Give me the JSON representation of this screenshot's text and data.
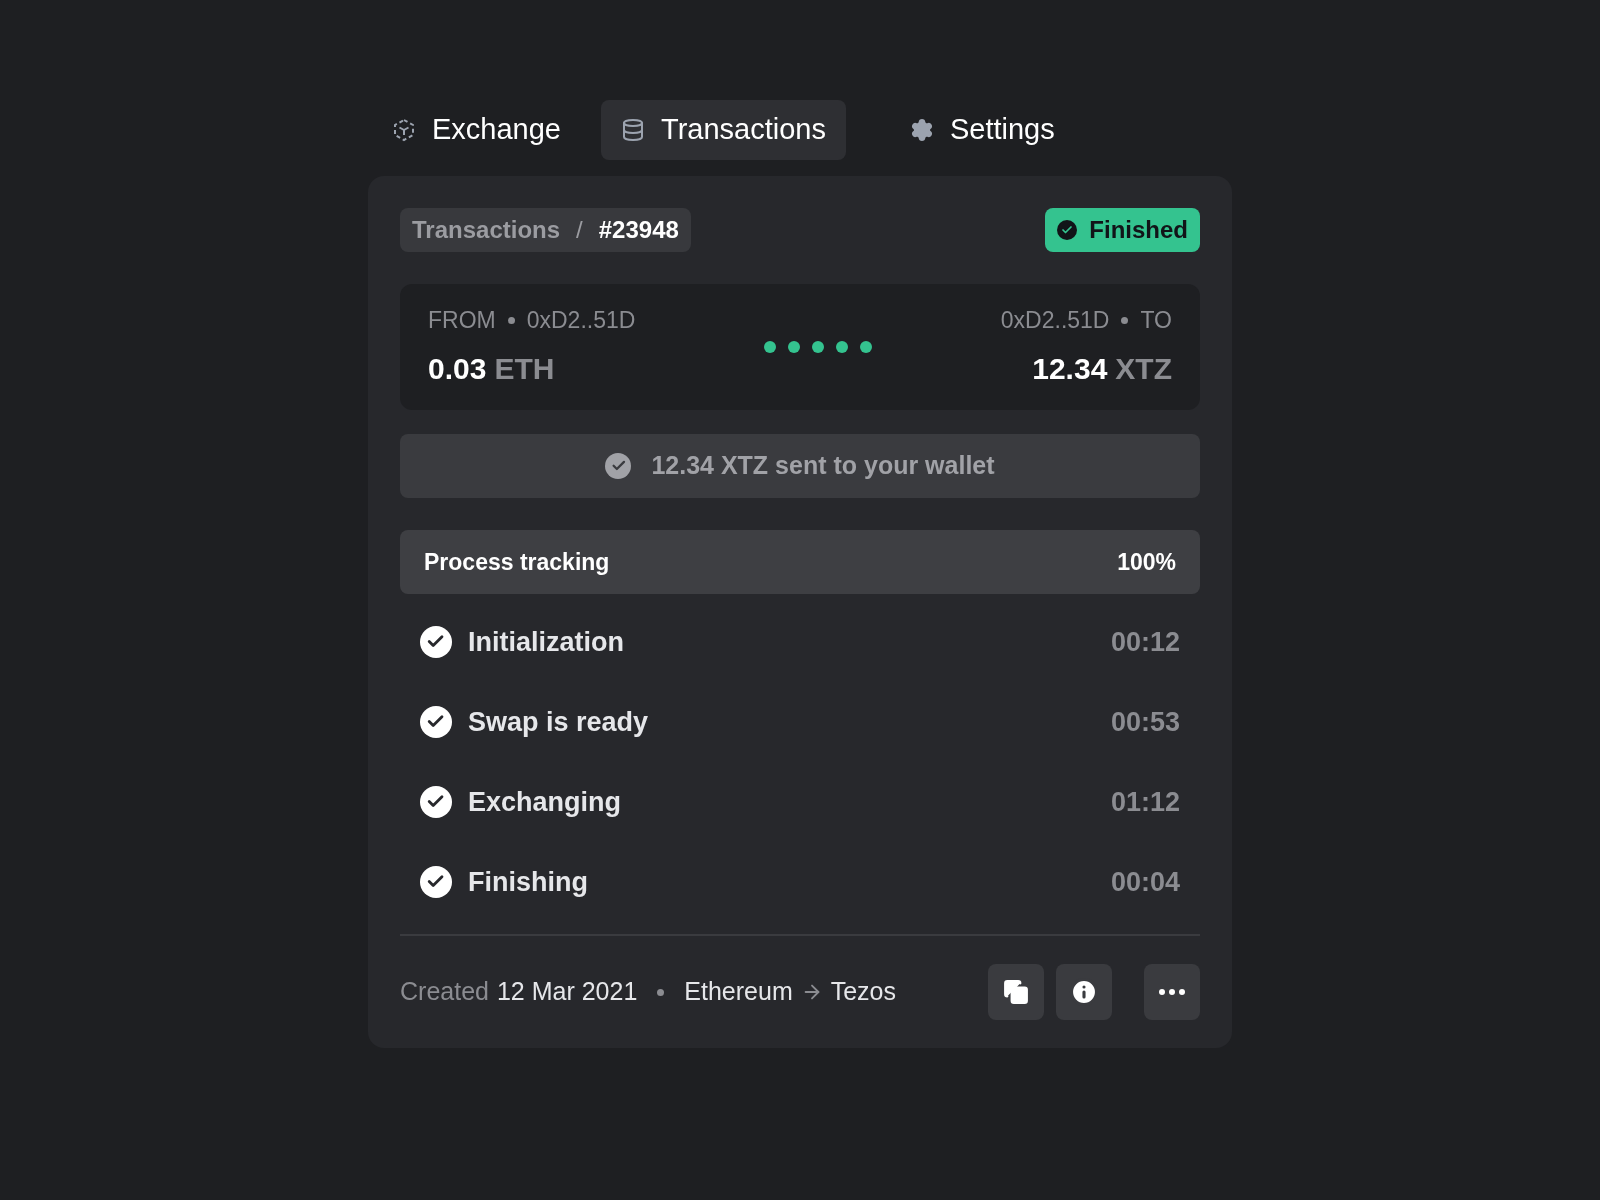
{
  "tabs": [
    {
      "label": "Exchange",
      "selected": false
    },
    {
      "label": "Transactions",
      "selected": true
    },
    {
      "label": "Settings",
      "selected": false
    }
  ],
  "breadcrumb": {
    "parent": "Transactions",
    "separator": "/",
    "current": "#23948"
  },
  "status": {
    "label": "Finished",
    "kind": "success"
  },
  "transfer": {
    "from": {
      "label": "FROM",
      "address": "0xD2..51D",
      "amount": "0.03",
      "currency": "ETH"
    },
    "to": {
      "label": "TO",
      "address": "0xD2..51D",
      "amount": "12.34",
      "currency": "XTZ"
    }
  },
  "notice": "12.34 XTZ sent to your wallet",
  "tracking": {
    "title": "Process tracking",
    "percent": "100%",
    "steps": [
      {
        "label": "Initialization",
        "time": "00:12",
        "done": true
      },
      {
        "label": "Swap is ready",
        "time": "00:53",
        "done": true
      },
      {
        "label": "Exchanging",
        "time": "01:12",
        "done": true
      },
      {
        "label": "Finishing",
        "time": "00:04",
        "done": true
      }
    ]
  },
  "footer": {
    "created_label": "Created",
    "date": "12 Mar 2021",
    "from_network": "Ethereum",
    "to_network": "Tezos"
  }
}
